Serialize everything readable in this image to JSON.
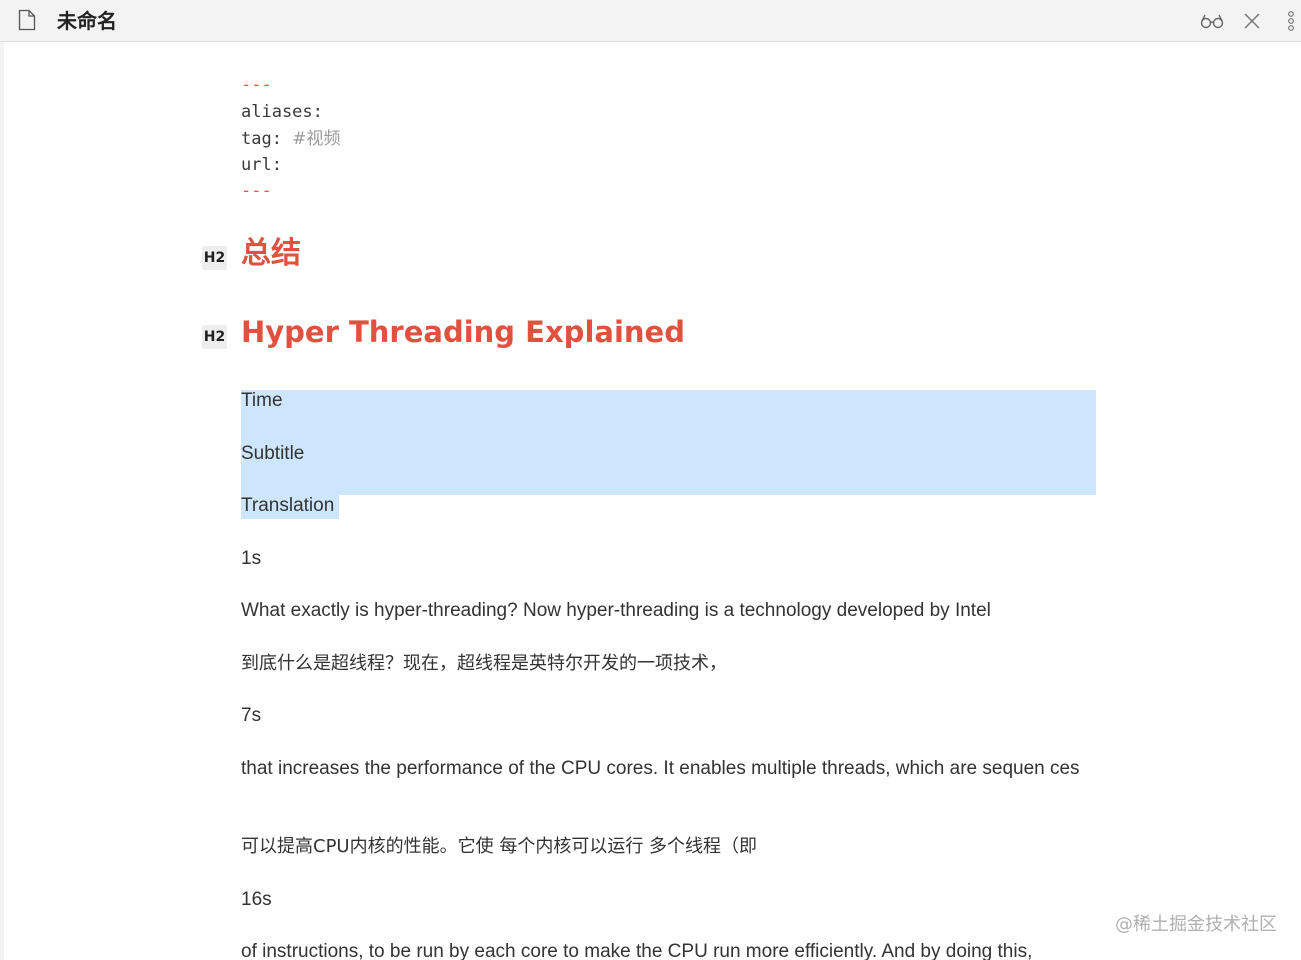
{
  "window": {
    "title": "未命名"
  },
  "titlebar": {
    "icons": {
      "document": "document-icon",
      "reading_mode": "glasses-icon",
      "close": "close-icon",
      "more": "more-vertical-icon"
    }
  },
  "frontmatter": {
    "open": "---",
    "aliases_key": "aliases:",
    "tag_key": "tag:",
    "tag_value": "#视频",
    "url_key": "url:",
    "close": "---"
  },
  "headings": [
    {
      "level": "H2",
      "text": "总结"
    },
    {
      "level": "H2",
      "text": "Hyper Threading Explained"
    }
  ],
  "paragraphs": [
    "Time",
    "Subtitle",
    "Translation",
    "1s",
    "What exactly is hyper-threading? Now  hyper-threading is a technology developed by Intel",
    "到底什么是超线程？现在，超线程是英特尔开发的一项技术，",
    "7s",
    "that increases the performance of the CPU cores. It enables multiple threads, which are sequen ces",
    "可以提高CPU内核的性能。它使 每个内核可以运行 多个线程（即",
    "16s",
    "of instructions, to be run by each core to make  the CPU run more efficiently. And by doing this,"
  ],
  "watermark": "@稀土掘金技术社区",
  "colors": {
    "heading": "#e0523f",
    "frontmatter_dash": "#e05a47",
    "selection": "#cde6fd",
    "titlebar": "#f3f3f3"
  }
}
